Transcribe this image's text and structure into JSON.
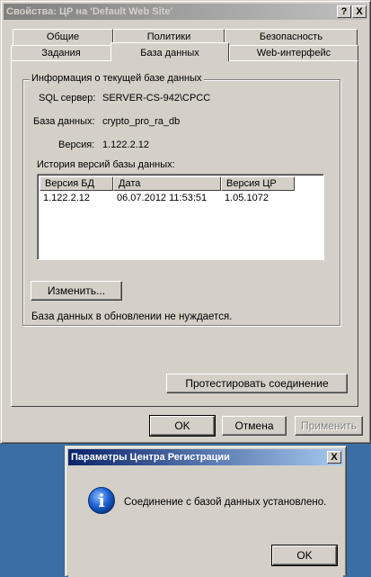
{
  "main_window": {
    "title": "Свойства: ЦР на 'Default Web Site'",
    "help_button": "?",
    "close_button": "X"
  },
  "tabs_row1": [
    "Общие",
    "Политики",
    "Безопасность"
  ],
  "tabs_row2": [
    "Задания",
    "База данных",
    "Web-интерфейс"
  ],
  "active_tab": "База данных",
  "db_info": {
    "group_title": "Информация о текущей базе данных",
    "sql_server_label": "SQL сервер:",
    "sql_server_value": "SERVER-CS-942\\CPCC",
    "database_label": "База данных:",
    "database_value": "crypto_pro_ra_db",
    "version_label": "Версия:",
    "version_value": "1.122.2.12",
    "history_label": "История версий базы данных:",
    "history_columns": [
      "Версия БД",
      "Дата",
      "Версия ЦР"
    ],
    "history_rows": [
      [
        "1.122.2.12",
        "06.07.2012 11:53:51",
        "1.05.1072"
      ]
    ]
  },
  "change_button": "Изменить...",
  "update_status": "База данных в обновлении не нуждается.",
  "test_connection_button": "Протестировать соединение",
  "footer_buttons": {
    "ok": "OK",
    "cancel": "Отмена",
    "apply": "Применить"
  },
  "message_box": {
    "title": "Параметры Центра Регистрации",
    "close_button": "X",
    "icon_glyph": "i",
    "message": "Соединение с базой данных установлено.",
    "ok": "OK"
  },
  "colors": {
    "desktop": "#3a6ea5",
    "window_face": "#d4d0c8",
    "active_title": "#0a246a",
    "info_icon": "#1b5fd0"
  }
}
